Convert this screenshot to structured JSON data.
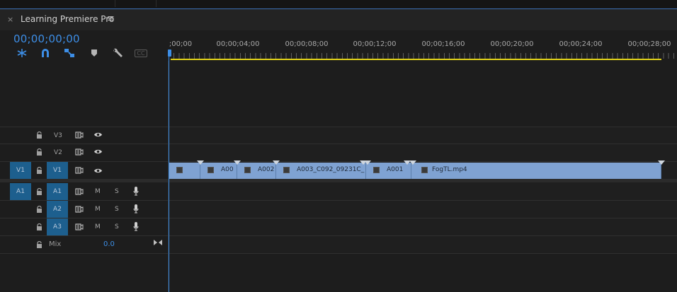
{
  "panel": {
    "close_glyph": "×",
    "title": "Learning Premiere Pro",
    "menu_glyph": "≡",
    "timecode": "00;00;00;00"
  },
  "tools": [
    {
      "name": "insert-overwrite-icon"
    },
    {
      "name": "snap-icon"
    },
    {
      "name": "linked-selection-icon"
    },
    {
      "name": "add-marker-icon"
    },
    {
      "name": "wrench-icon"
    },
    {
      "name": "captions-icon",
      "text": "CC"
    }
  ],
  "ruler": {
    "labels": [
      ";00;00",
      "00;00;04;00",
      "00;00;08;00",
      "00;00;12;00",
      "00;00;16;00",
      "00;00;20;00",
      "00;00;24;00",
      "00;00;28;00"
    ]
  },
  "tracks": {
    "video": [
      {
        "id": "V3",
        "source": "",
        "target": "V3"
      },
      {
        "id": "V2",
        "source": "",
        "target": "V2"
      },
      {
        "id": "V1",
        "source": "V1",
        "target": "V1"
      }
    ],
    "audio": [
      {
        "id": "A1",
        "source": "A1",
        "target": "A1",
        "mute": "M",
        "solo": "S"
      },
      {
        "id": "A2",
        "source": "",
        "target": "A2",
        "mute": "M",
        "solo": "S"
      },
      {
        "id": "A3",
        "source": "",
        "target": "A3",
        "mute": "M",
        "solo": "S"
      }
    ],
    "mix": {
      "label": "Mix",
      "value": "0.0"
    }
  },
  "clips": [
    {
      "name": ""
    },
    {
      "name": "A00"
    },
    {
      "name": "A002"
    },
    {
      "name": "A003_C092_09231C_"
    },
    {
      "name": "A001"
    },
    {
      "name": "FogTL.mp4"
    }
  ],
  "colors": {
    "accent": "#3d8ee6",
    "clip": "#7fa2d2",
    "work_area": "#e2d318",
    "target_on": "#1d5f8e"
  }
}
